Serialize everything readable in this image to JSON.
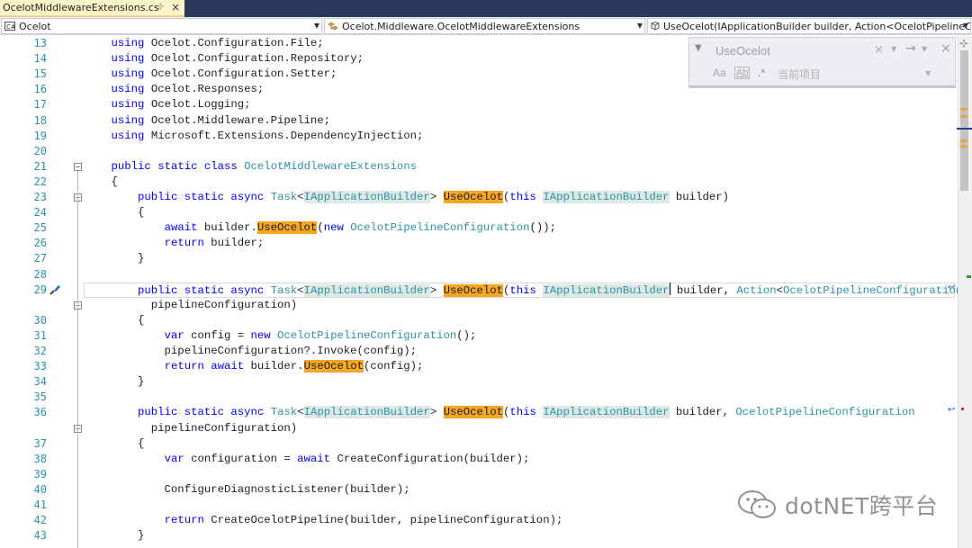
{
  "tab": {
    "title": "OcelotMiddlewareExtensions.cs",
    "pin_glyph": "⊹",
    "close_glyph": "×"
  },
  "navbar": {
    "project": "Ocelot",
    "type_scope": "Ocelot.Middleware.OcelotMiddlewareExtensions",
    "member": "UseOcelot(IApplicationBuilder builder, Action<OcelotPipelineCc"
  },
  "find": {
    "search_value": "UseOcelot",
    "match_case_label": "Aa",
    "whole_word_label": "Ab",
    "regex_label": ".*",
    "scope": "当前项目"
  },
  "watermark": {
    "text": "dotNET跨平台"
  },
  "code_lines": [
    {
      "n": "13",
      "text": "    using Ocelot.Configuration.File;"
    },
    {
      "n": "14",
      "text": "    using Ocelot.Configuration.Repository;"
    },
    {
      "n": "15",
      "text": "    using Ocelot.Configuration.Setter;"
    },
    {
      "n": "16",
      "text": "    using Ocelot.Responses;"
    },
    {
      "n": "17",
      "text": "    using Ocelot.Logging;"
    },
    {
      "n": "18",
      "text": "    using Ocelot.Middleware.Pipeline;"
    },
    {
      "n": "19",
      "text": "    using Microsoft.Extensions.DependencyInjection;"
    },
    {
      "n": "20",
      "text": ""
    },
    {
      "n": "21",
      "text": "    public static class OcelotMiddlewareExtensions"
    },
    {
      "n": "22",
      "text": "    {"
    },
    {
      "n": "23",
      "text": "        public static async Task<IApplicationBuilder> UseOcelot(this IApplicationBuilder builder)"
    },
    {
      "n": "24",
      "text": "        {"
    },
    {
      "n": "25",
      "text": "            await builder.UseOcelot(new OcelotPipelineConfiguration());"
    },
    {
      "n": "26",
      "text": "            return builder;"
    },
    {
      "n": "27",
      "text": "        }"
    },
    {
      "n": "28",
      "text": ""
    },
    {
      "n": "29",
      "text": "        public static async Task<IApplicationBuilder> UseOcelot(this IApplicationBuilder builder, Action<OcelotPipelineConfiguration>"
    },
    {
      "n": "",
      "text": "          pipelineConfiguration)"
    },
    {
      "n": "30",
      "text": "        {"
    },
    {
      "n": "31",
      "text": "            var config = new OcelotPipelineConfiguration();"
    },
    {
      "n": "32",
      "text": "            pipelineConfiguration?.Invoke(config);"
    },
    {
      "n": "33",
      "text": "            return await builder.UseOcelot(config);"
    },
    {
      "n": "34",
      "text": "        }"
    },
    {
      "n": "35",
      "text": ""
    },
    {
      "n": "36",
      "text": "        public static async Task<IApplicationBuilder> UseOcelot(this IApplicationBuilder builder, OcelotPipelineConfiguration"
    },
    {
      "n": "",
      "text": "          pipelineConfiguration)"
    },
    {
      "n": "37",
      "text": "        {"
    },
    {
      "n": "38",
      "text": "            var configuration = await CreateConfiguration(builder);"
    },
    {
      "n": "39",
      "text": ""
    },
    {
      "n": "40",
      "text": "            ConfigureDiagnosticListener(builder);"
    },
    {
      "n": "41",
      "text": ""
    },
    {
      "n": "42",
      "text": "            return CreateOcelotPipeline(builder, pipelineConfiguration);"
    },
    {
      "n": "43",
      "text": "        }"
    }
  ],
  "colors": {
    "keyword": "#0000ff",
    "type": "#2b91af",
    "line_number": "#2b91af",
    "match_highlight": "#f5a623",
    "reference_highlight": "#dde9e2",
    "tab_active": "#fef5c9",
    "title_bar": "#2b3a5a"
  }
}
